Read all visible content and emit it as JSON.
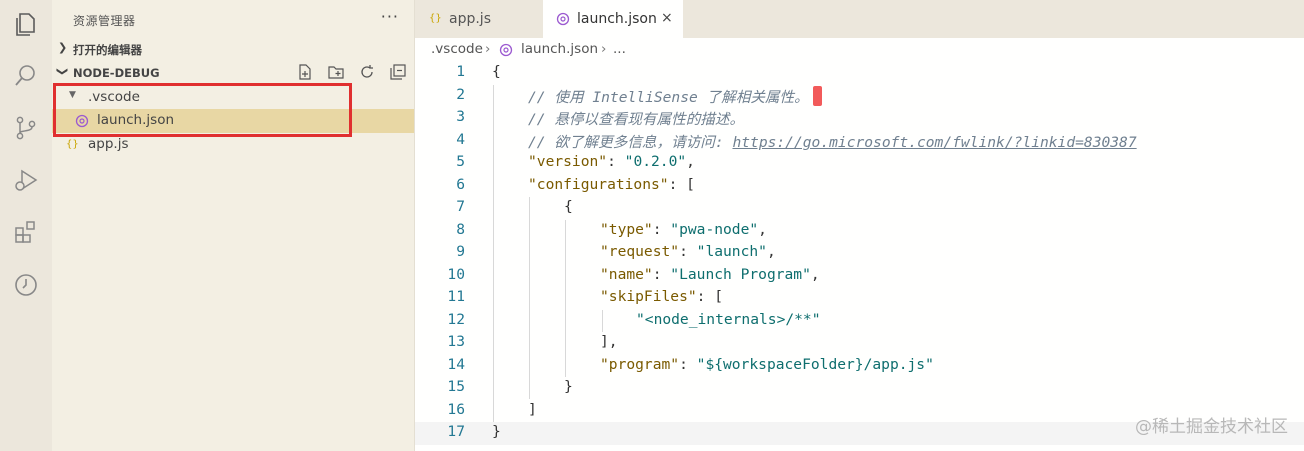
{
  "activity_bar": {
    "icons": [
      "files-icon",
      "search-icon",
      "source-control-icon",
      "run-debug-icon",
      "extensions-icon",
      "timeline-icon"
    ]
  },
  "sidebar": {
    "title": "资源管理器",
    "more": "···",
    "open_editors_label": "打开的编辑器",
    "project_label": "NODE-DEBUG",
    "tree": {
      "folder": ".vscode",
      "file_selected": "launch.json",
      "file_other": "app.js"
    }
  },
  "tabs": [
    {
      "label": "app.js",
      "icon": "js-file-icon",
      "active": false
    },
    {
      "label": "launch.json",
      "icon": "json-settings-icon",
      "active": true,
      "close": "×"
    }
  ],
  "breadcrumb": {
    "folder": ".vscode",
    "sep1": "›",
    "file": "launch.json",
    "sep2": "›",
    "more": "..."
  },
  "editor": {
    "line_numbers": [
      "1",
      "2",
      "3",
      "4",
      "5",
      "6",
      "7",
      "8",
      "9",
      "10",
      "11",
      "12",
      "13",
      "14",
      "15",
      "16",
      "17"
    ],
    "comment1": "// 使用 IntelliSense 了解相关属性。",
    "comment2": "// 悬停以查看现有属性的描述。",
    "comment3_prefix": "// 欲了解更多信息，请访问: ",
    "comment3_link": "https://go.microsoft.com/fwlink/?linkid=830387",
    "version_key": "\"version\"",
    "version_val": "\"0.2.0\"",
    "configurations_key": "\"configurations\"",
    "type_key": "\"type\"",
    "type_val": "\"pwa-node\"",
    "request_key": "\"request\"",
    "request_val": "\"launch\"",
    "name_key": "\"name\"",
    "name_val": "\"Launch Program\"",
    "skipfiles_key": "\"skipFiles\"",
    "skipfiles_val": "\"<node_internals>/**\"",
    "program_key": "\"program\"",
    "program_val": "\"${workspaceFolder}/app.js\""
  },
  "watermark": "@稀土掘金技术社区",
  "colors": {
    "highlight_box": "#e02f2f",
    "selected_row": "#e8d7a4",
    "cursor": "#f25a5a"
  }
}
